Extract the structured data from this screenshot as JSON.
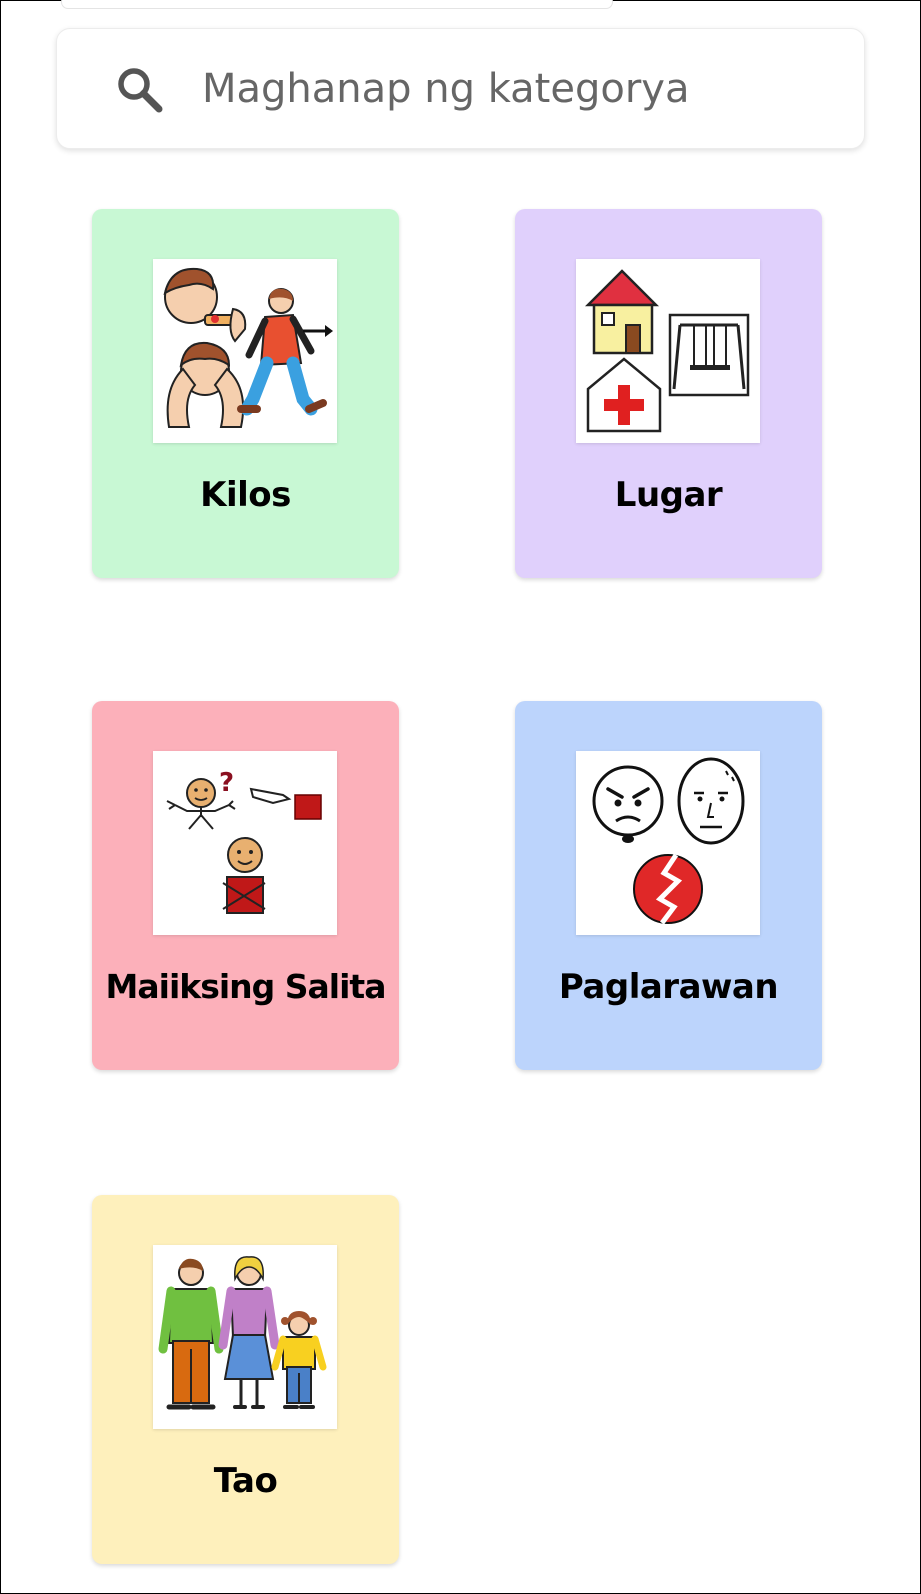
{
  "search": {
    "placeholder": "Maghanap ng kategorya",
    "icon": "search-icon"
  },
  "categories": [
    {
      "label": "Kilos",
      "color": "#c8f8d4",
      "icon": "actions-icon"
    },
    {
      "label": "Lugar",
      "color": "#e0d0fc",
      "icon": "places-icon"
    },
    {
      "label": "Maiiksing Salita",
      "color": "#fcb0ba",
      "icon": "short-words-icon"
    },
    {
      "label": "Paglarawan",
      "color": "#bcd4fc",
      "icon": "describe-icon"
    },
    {
      "label": "Tao",
      "color": "#fef0bc",
      "icon": "people-icon"
    }
  ]
}
